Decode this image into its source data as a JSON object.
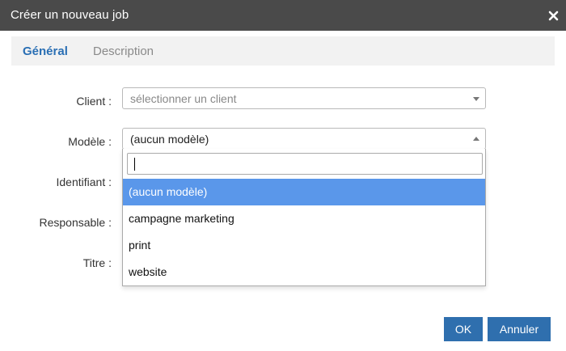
{
  "dialog": {
    "title": "Créer un nouveau job",
    "close_icon": "close-icon"
  },
  "tabs": [
    {
      "label": "Général",
      "active": true
    },
    {
      "label": "Description",
      "active": false
    }
  ],
  "form": {
    "client": {
      "label": "Client :",
      "placeholder": "sélectionner un client"
    },
    "modele": {
      "label": "Modèle :",
      "value": "(aucun modèle)",
      "open": true
    },
    "identifiant": {
      "label": "Identifiant :"
    },
    "responsable": {
      "label": "Responsable :"
    },
    "titre": {
      "label": "Titre :"
    }
  },
  "dropdown": {
    "search_value": "",
    "options": [
      "(aucun modèle)",
      "campagne marketing",
      "print",
      "website"
    ],
    "highlighted_index": 0
  },
  "buttons": {
    "ok": "OK",
    "cancel": "Annuler"
  },
  "colors": {
    "titlebar": "#4a4a4a",
    "accent": "#2a6fb4",
    "button": "#2f6fae",
    "highlight": "#5a97ea"
  }
}
